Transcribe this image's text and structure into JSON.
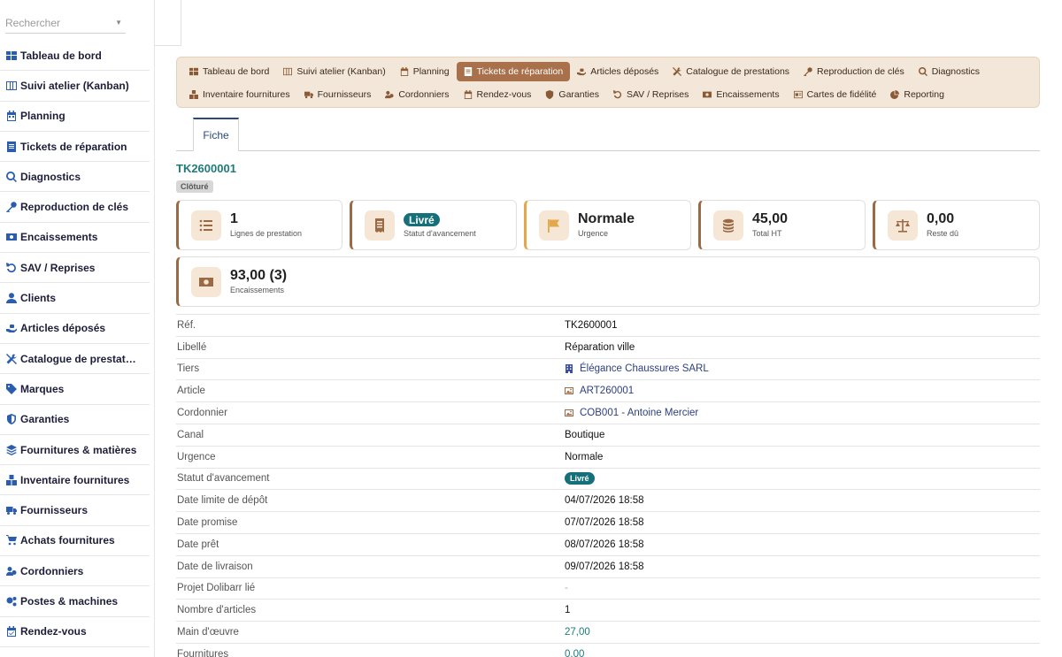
{
  "sidebar": {
    "search_placeholder": "Rechercher",
    "items": [
      {
        "label": "Tableau de bord",
        "icon": "grid-icon"
      },
      {
        "label": "Suivi atelier (Kanban)",
        "icon": "kanban-icon"
      },
      {
        "label": "Planning",
        "icon": "calendar-icon"
      },
      {
        "label": "Tickets de réparation",
        "icon": "ticket-icon"
      },
      {
        "label": "Diagnostics",
        "icon": "search-icon"
      },
      {
        "label": "Reproduction de clés",
        "icon": "key-icon"
      },
      {
        "label": "Encaissements",
        "icon": "money-icon"
      },
      {
        "label": "SAV / Reprises",
        "icon": "undo-icon"
      },
      {
        "label": "Clients",
        "icon": "user-icon"
      },
      {
        "label": "Articles déposés",
        "icon": "hand-icon"
      },
      {
        "label": "Catalogue de prestat…",
        "icon": "tools-icon"
      },
      {
        "label": "Marques",
        "icon": "tag-icon"
      },
      {
        "label": "Garanties",
        "icon": "shield-icon"
      },
      {
        "label": "Fournitures & matières",
        "icon": "layers-icon"
      },
      {
        "label": "Inventaire fournitures",
        "icon": "boxes-icon"
      },
      {
        "label": "Fournisseurs",
        "icon": "truck-icon"
      },
      {
        "label": "Achats fournitures",
        "icon": "cart-icon"
      },
      {
        "label": "Cordonniers",
        "icon": "users-icon"
      },
      {
        "label": "Postes & machines",
        "icon": "gears-icon"
      },
      {
        "label": "Rendez-vous",
        "icon": "calendar-check-icon"
      }
    ]
  },
  "module_menu": {
    "row1": [
      {
        "label": "Tableau de bord",
        "icon": "grid-icon",
        "active": false
      },
      {
        "label": "Suivi atelier (Kanban)",
        "icon": "kanban-icon",
        "active": false
      },
      {
        "label": "Planning",
        "icon": "calendar-icon",
        "active": false
      },
      {
        "label": "Tickets de réparation",
        "icon": "ticket-icon",
        "active": true
      },
      {
        "label": "Articles déposés",
        "icon": "hand-icon",
        "active": false
      },
      {
        "label": "Catalogue de prestations",
        "icon": "tools-icon",
        "active": false
      },
      {
        "label": "Reproduction de clés",
        "icon": "key-icon",
        "active": false
      },
      {
        "label": "Diagnostics",
        "icon": "search-icon",
        "active": false
      }
    ],
    "row2": [
      {
        "label": "Inventaire fournitures",
        "icon": "boxes-icon",
        "active": false
      },
      {
        "label": "Fournisseurs",
        "icon": "truck-icon",
        "active": false
      },
      {
        "label": "Cordonniers",
        "icon": "users-icon",
        "active": false
      },
      {
        "label": "Rendez-vous",
        "icon": "calendar-check-icon",
        "active": false
      },
      {
        "label": "Garanties",
        "icon": "shield-icon",
        "active": false
      },
      {
        "label": "SAV / Reprises",
        "icon": "undo-icon",
        "active": false
      },
      {
        "label": "Encaissements",
        "icon": "money-icon",
        "active": false
      },
      {
        "label": "Cartes de fidélité",
        "icon": "card-icon",
        "active": false
      },
      {
        "label": "Reporting",
        "icon": "pie-icon",
        "active": false
      }
    ]
  },
  "tabs": [
    {
      "label": "Fiche"
    }
  ],
  "record": {
    "ref": "TK2600001",
    "status": "Clôturé"
  },
  "kpis": [
    {
      "value": "1",
      "label": "Lignes de prestation",
      "icon": "list-icon"
    },
    {
      "value": "Livré",
      "label": "Statut d'avancement",
      "icon": "receipt-icon"
    },
    {
      "value": "Normale",
      "label": "Urgence",
      "icon": "flag-icon"
    },
    {
      "value": "45,00",
      "label": "Total HT",
      "icon": "coins-icon"
    },
    {
      "value": "0,00",
      "label": "Reste dû",
      "icon": "scale-icon"
    },
    {
      "value": "93,00 (3)",
      "label": "Encaissements",
      "icon": "money-icon"
    }
  ],
  "details": [
    {
      "label": "Réf.",
      "value": "TK2600001"
    },
    {
      "label": "Libellé",
      "value": "Réparation ville"
    },
    {
      "label": "Tiers",
      "value": "Élégance Chaussures SARL",
      "icon": "building-icon"
    },
    {
      "label": "Article",
      "value": "ART260001",
      "icon": "image-icon"
    },
    {
      "label": "Cordonnier",
      "value": "COB001 - Antoine Mercier",
      "icon": "image-icon"
    },
    {
      "label": "Canal",
      "value": "Boutique"
    },
    {
      "label": "Urgence",
      "value": "Normale"
    },
    {
      "label": "Statut d'avancement",
      "value": "Livré"
    },
    {
      "label": "Date limite de dépôt",
      "value": "04/07/2026 18:58"
    },
    {
      "label": "Date promise",
      "value": "07/07/2026 18:58"
    },
    {
      "label": "Date prêt",
      "value": "08/07/2026 18:58"
    },
    {
      "label": "Date de livraison",
      "value": "09/07/2026 18:58"
    },
    {
      "label": "Projet Dolibarr lié",
      "value": "-"
    },
    {
      "label": "Nombre d'articles",
      "value": "1"
    },
    {
      "label": "Main d'œuvre",
      "value": "27,00"
    },
    {
      "label": "Fournitures",
      "value": "0,00"
    }
  ],
  "colors": {
    "accent_brown": "#a9714b",
    "menu_bg": "#f3e7d9",
    "teal": "#16707a",
    "link_blue": "#2b3f82",
    "sidebar_icon": "#2a5db0"
  }
}
